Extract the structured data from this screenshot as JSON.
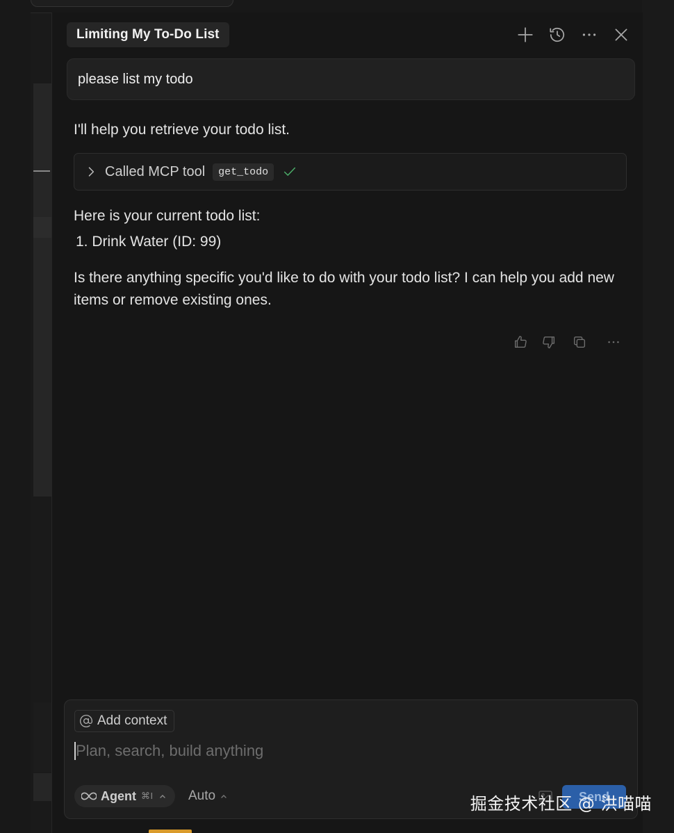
{
  "chat": {
    "title": "Limiting My To-Do List",
    "header_icons": [
      "plus-icon",
      "history-icon",
      "more-icon",
      "close-icon"
    ]
  },
  "messages": {
    "user": "please list my todo",
    "assistant_intro": "I'll help you retrieve your todo list.",
    "tool_call": {
      "label": "Called MCP tool",
      "tool_name": "get_todo",
      "status": "success"
    },
    "list_heading": "Here is your current todo list:",
    "list_item_1": "1. Drink Water (ID: 99)",
    "followup": "Is there anything specific you'd like to do with your todo list? I can help you add new items or remove existing ones."
  },
  "message_actions": [
    "thumbs-up-icon",
    "thumbs-down-icon",
    "copy-icon",
    "more-icon"
  ],
  "composer": {
    "add_context_label": "Add context",
    "placeholder": "Plan, search, build anything",
    "mode_label": "Agent",
    "mode_shortcut": "⌘I",
    "model_label": "Auto",
    "send_label": "Send"
  },
  "watermark": "掘金技术社区 @ 洪喵喵",
  "colors": {
    "background": "#181818",
    "panel": "#161616",
    "accent_send": "#2b5fa8",
    "success_check": "#4caf6a"
  }
}
